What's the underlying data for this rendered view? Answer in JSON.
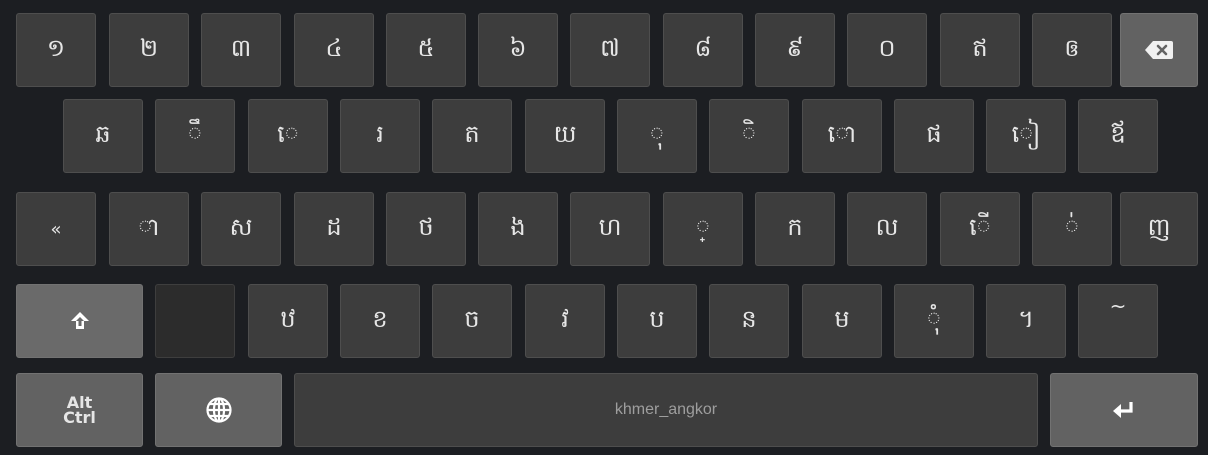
{
  "keyboard": {
    "row1": [
      "១",
      "២",
      "៣",
      "៤",
      "៥",
      "៦",
      "៧",
      "៨",
      "៩",
      "០",
      "ឥ",
      "ឲ"
    ],
    "row2": [
      "ឆ",
      "ឹ",
      "េ",
      "រ",
      "ត",
      "យ",
      "ុ",
      "ិ",
      "ោ",
      "ផ",
      "ៀ",
      "ឪ"
    ],
    "row3": [
      "«",
      "ា",
      "ស",
      "ដ",
      "ថ",
      "ង",
      "ហ",
      "្",
      "ក",
      "ល",
      "ើ",
      "់",
      "ញ"
    ],
    "row4": [
      "",
      "ឋ",
      "ខ",
      "ច",
      "វ",
      "ប",
      "ន",
      "ម",
      "ុំ",
      "។",
      "~"
    ],
    "alt_ctrl": {
      "line1": "Alt",
      "line2": "Ctrl"
    },
    "space_label": "khmer_angkor",
    "icons": {
      "backspace": "backspace-icon",
      "shift": "shift-icon",
      "globe": "globe-icon",
      "enter": "enter-icon"
    },
    "colors": {
      "background": "#1c1e22",
      "key": "#3d3d3d",
      "function_key": "#626262",
      "key_text": "#e6e6e6"
    }
  }
}
